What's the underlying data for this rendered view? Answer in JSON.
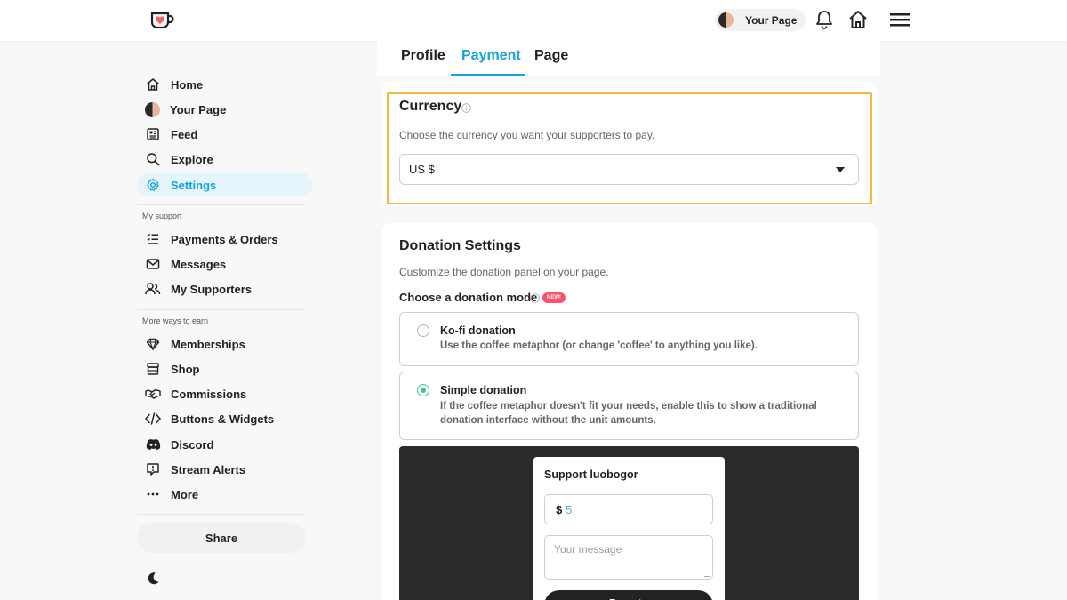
{
  "topbar": {
    "page_pill_label": "Your Page"
  },
  "sidebar": {
    "items": [
      {
        "label": "Home",
        "icon": "home-icon"
      },
      {
        "label": "Your Page",
        "icon": "avatar"
      },
      {
        "label": "Feed",
        "icon": "feed-icon"
      },
      {
        "label": "Explore",
        "icon": "search-icon"
      },
      {
        "label": "Settings",
        "icon": "gear-icon",
        "active": true
      }
    ],
    "section_support": "My support",
    "support_items": [
      {
        "label": "Payments & Orders",
        "icon": "list-icon"
      },
      {
        "label": "Messages",
        "icon": "mail-icon"
      },
      {
        "label": "My Supporters",
        "icon": "supporters-icon"
      }
    ],
    "section_earn": "More ways to earn",
    "earn_items": [
      {
        "label": "Memberships",
        "icon": "diamond-icon"
      },
      {
        "label": "Shop",
        "icon": "shop-icon"
      },
      {
        "label": "Commissions",
        "icon": "handshake-icon"
      },
      {
        "label": "Buttons & Widgets",
        "icon": "code-icon"
      },
      {
        "label": "Discord",
        "icon": "discord-icon"
      },
      {
        "label": "Stream Alerts",
        "icon": "alert-icon"
      },
      {
        "label": "More",
        "icon": "more-icon"
      }
    ],
    "share_label": "Share"
  },
  "tabs": [
    {
      "label": "Profile"
    },
    {
      "label": "Payment",
      "active": true
    },
    {
      "label": "Page"
    }
  ],
  "currency": {
    "title": "Currency",
    "description": "Choose the currency you want your supporters to pay.",
    "selected": "US $"
  },
  "donation": {
    "title": "Donation Settings",
    "description": "Customize the donation panel on your page.",
    "mode_label": "Choose a donation mode",
    "new_badge": "NEW!",
    "options": [
      {
        "title": "Ko-fi donation",
        "description": "Use the coffee metaphor (or change 'coffee' to anything you like).",
        "checked": false
      },
      {
        "title": "Simple donation",
        "description": "If the coffee metaphor doesn't fit your needs, enable this to show a traditional donation interface without the unit amounts.",
        "checked": true
      }
    ]
  },
  "preview": {
    "title": "Support luobogor",
    "currency_symbol": "$",
    "amount": "5",
    "message_placeholder": "Your message",
    "button_label": "Donate"
  },
  "colors": {
    "accent": "#13a3de",
    "highlight": "#f6b73c",
    "radio_checked": "#39c8a0",
    "new_badge": "#ff4f6d"
  }
}
